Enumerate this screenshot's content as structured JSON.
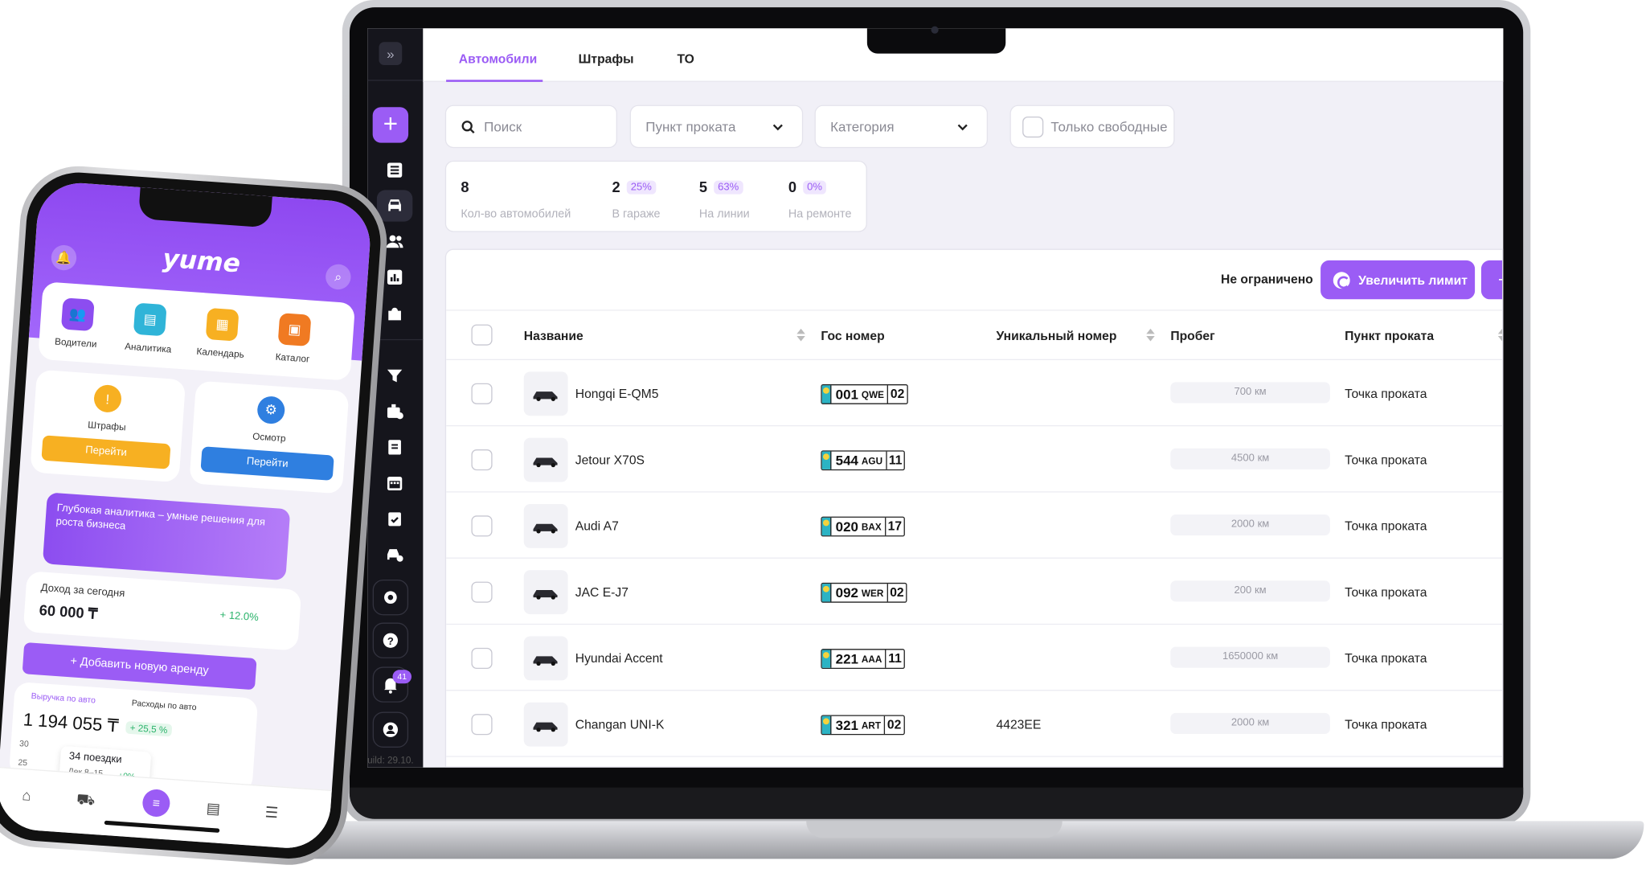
{
  "colors": {
    "accent": "#9b5cf5",
    "sidebar": "#15151c",
    "background": "#f1f0f7"
  },
  "sidebar": {
    "notification_badge": "41",
    "footer_text": "uild: 29.10.",
    "icons": [
      "expand-icon",
      "add-icon",
      "list-icon",
      "car-icon",
      "users-icon",
      "chart-icon",
      "puzzle-icon",
      "filter-icon",
      "briefcase-icon",
      "document-icon",
      "calendar-icon",
      "checklist-icon",
      "car-service-icon",
      "settings-icon",
      "help-icon",
      "bell-icon",
      "profile-icon"
    ]
  },
  "tabs": [
    {
      "label": "Автомобили",
      "active": true
    },
    {
      "label": "Штрафы"
    },
    {
      "label": "ТО"
    }
  ],
  "filters": {
    "search_placeholder": "Поиск",
    "rental_point": "Пункт проката",
    "category": "Категория",
    "only_free": "Только свободные"
  },
  "stats": [
    {
      "value": "8",
      "label": "Кол-во автомобилей"
    },
    {
      "value": "2",
      "percent": "25%",
      "label": "В гараже"
    },
    {
      "value": "5",
      "percent": "63%",
      "label": "На линии"
    },
    {
      "value": "0",
      "percent": "0%",
      "label": "На ремонте"
    }
  ],
  "limit": {
    "text": "Не ограничено",
    "button": "Увеличить лимит",
    "add": "+"
  },
  "table": {
    "columns": [
      "Название",
      "Гос номер",
      "Уникальный номер",
      "Пробег",
      "Пункт проката"
    ],
    "rows": [
      {
        "name": "Hongqi E-QM5",
        "plate_digits": "001",
        "plate_letters": "QWE",
        "plate_region": "02",
        "unique": "",
        "mileage": "700 км",
        "point": "Точка проката"
      },
      {
        "name": "Jetour X70S",
        "plate_digits": "544",
        "plate_letters": "AGU",
        "plate_region": "11",
        "unique": "",
        "mileage": "4500 км",
        "point": "Точка проката"
      },
      {
        "name": "Audi A7",
        "plate_digits": "020",
        "plate_letters": "BAX",
        "plate_region": "17",
        "unique": "",
        "mileage": "2000 км",
        "point": "Точка проката"
      },
      {
        "name": "JAC E-J7",
        "plate_digits": "092",
        "plate_letters": "WER",
        "plate_region": "02",
        "unique": "",
        "mileage": "200 км",
        "point": "Точка проката"
      },
      {
        "name": "Hyundai Accent",
        "plate_digits": "221",
        "plate_letters": "AAA",
        "plate_region": "11",
        "unique": "",
        "mileage": "1650000 км",
        "point": "Точка проката"
      },
      {
        "name": "Changan UNI-K",
        "plate_digits": "321",
        "plate_letters": "ART",
        "plate_region": "02",
        "unique": "4423EE",
        "mileage": "2000 км",
        "point": "Точка проката"
      }
    ]
  },
  "phone": {
    "logo": "yume",
    "quick": [
      {
        "label": "Водители",
        "color": "#8c4df0"
      },
      {
        "label": "Аналитика",
        "color": "#2fb4d8"
      },
      {
        "label": "Календарь",
        "color": "#f7b022"
      },
      {
        "label": "Каталог",
        "color": "#f07a22"
      }
    ],
    "fines": {
      "label": "Штрафы",
      "button": "Перейти"
    },
    "inspection": {
      "label": "Осмотр",
      "button": "Перейти"
    },
    "banner": "Глубокая аналитика – умные решения для роста бизнеса",
    "income_label": "Доход за сегодня",
    "income_value": "60 000 ₸",
    "income_change": "+ 12.0%",
    "add_rent": "+ Добавить новую аренду",
    "tab_revenue": "Выручка по авто",
    "tab_expenses": "Расходы по авто",
    "total": "1 194 055 ₸",
    "total_change": "+ 25,5 %",
    "y_ticks": [
      "30",
      "25"
    ],
    "trips": "34 поездки",
    "trips_period": "Дек 8–15",
    "trips_change": "+0%"
  }
}
